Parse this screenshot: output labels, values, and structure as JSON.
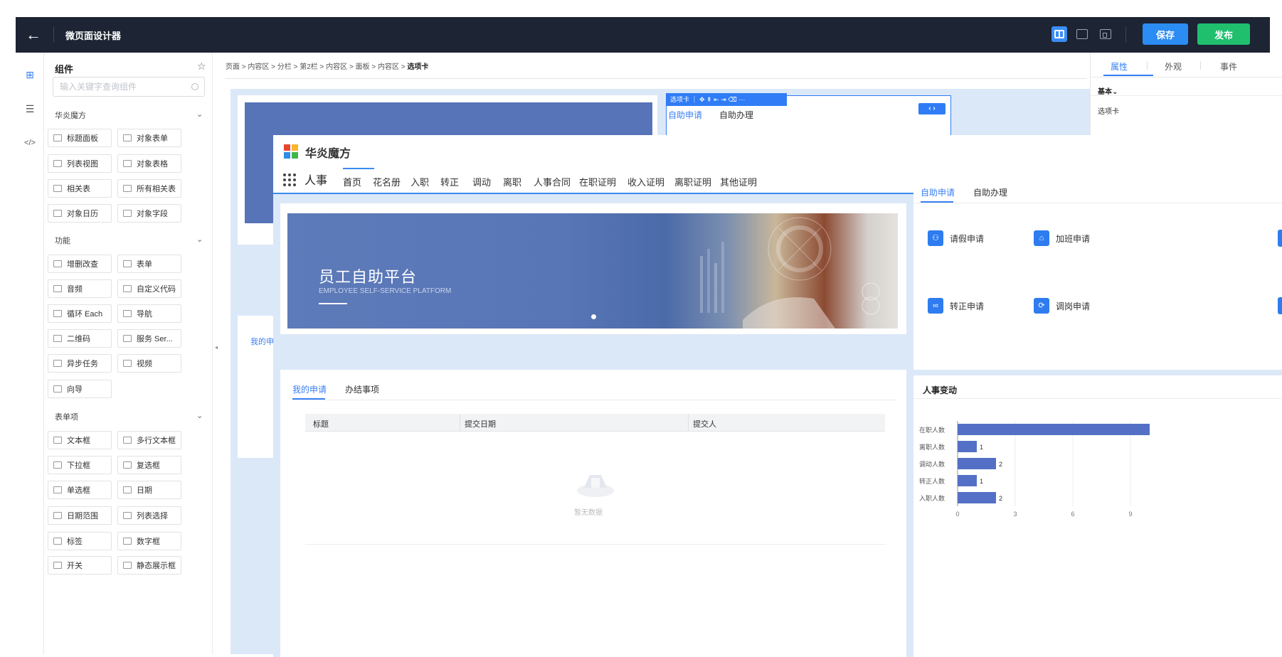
{
  "topbar": {
    "back_icon": "arrow-left-icon",
    "title": "微页面设计器",
    "save_label": "保存",
    "publish_label": "发布",
    "accent": "#2b8cf3",
    "publish_color": "#1fbf6e"
  },
  "component_panel": {
    "title": "组件",
    "search_placeholder": "输入关键字查询组件",
    "groups": [
      {
        "name": "华炎魔方",
        "items": [
          "标题面板",
          "对象表单",
          "列表视图",
          "对象表格",
          "相关表",
          "所有相关表",
          "对象日历",
          "对象字段"
        ]
      },
      {
        "name": "功能",
        "items": [
          "增删改查",
          "表单",
          "音频",
          "自定义代码",
          "循环 Each",
          "导航",
          "二维码",
          "服务 Ser...",
          "异步任务",
          "视频",
          "向导"
        ]
      },
      {
        "name": "表单项",
        "items": [
          "文本框",
          "多行文本框",
          "下拉框",
          "复选框",
          "单选框",
          "日期",
          "日期范围",
          "列表选择",
          "标签",
          "数字框",
          "开关",
          "静态展示框"
        ]
      }
    ]
  },
  "canvas": {
    "breadcrumb": [
      "页面",
      "内容区",
      "分栏",
      "第2栏",
      "内容区",
      "面板",
      "内容区",
      "选项卡"
    ],
    "crumb_sep": " > ",
    "tab_toolbar": "选项卡 ｜ ✥ ⇞ ⇤ ⇥ ⌫ ···",
    "behind_tabs": [
      "自助申请",
      "自助办理"
    ],
    "behind_my_apply": "我的申"
  },
  "props_panel": {
    "tabs": [
      "属性",
      "外观",
      "事件"
    ],
    "basic": "基本",
    "label": "选项卡"
  },
  "app": {
    "brand": "华炎魔方",
    "module": "人事",
    "nav": [
      "首页",
      "花名册",
      "入职",
      "转正",
      "调动",
      "离职",
      "人事合同",
      "在职证明",
      "收入证明",
      "离职证明",
      "其他证明"
    ],
    "banner": {
      "title": "员工自助平台",
      "subtitle": "EMPLOYEE SELF-SERVICE PLATFORM"
    },
    "apply": {
      "tabs": [
        "自助申请",
        "自助办理"
      ],
      "items": [
        {
          "label": "请假申请",
          "icon": "user-leave-icon"
        },
        {
          "label": "加班申请",
          "icon": "house-overtime-icon"
        },
        {
          "label": "转正申请",
          "icon": "rings-icon"
        },
        {
          "label": "调岗申请",
          "icon": "transfer-icon"
        }
      ]
    },
    "requests": {
      "tabs": [
        "我的申请",
        "办结事项"
      ],
      "columns": [
        "标题",
        "提交日期",
        "提交人"
      ],
      "empty": "暂无数据"
    },
    "hr": {
      "title": "人事变动"
    }
  },
  "chart_data": {
    "type": "bar",
    "orientation": "horizontal",
    "categories": [
      "在职人数",
      "离职人数",
      "调动人数",
      "转正人数",
      "入职人数"
    ],
    "values": [
      10,
      1,
      2,
      1,
      2
    ],
    "value_labels": [
      "",
      "1",
      "2",
      "1",
      "2"
    ],
    "xticks": [
      0,
      3,
      6,
      9
    ],
    "xlim": [
      0,
      10
    ],
    "grid": true,
    "color": "#5470c6"
  }
}
